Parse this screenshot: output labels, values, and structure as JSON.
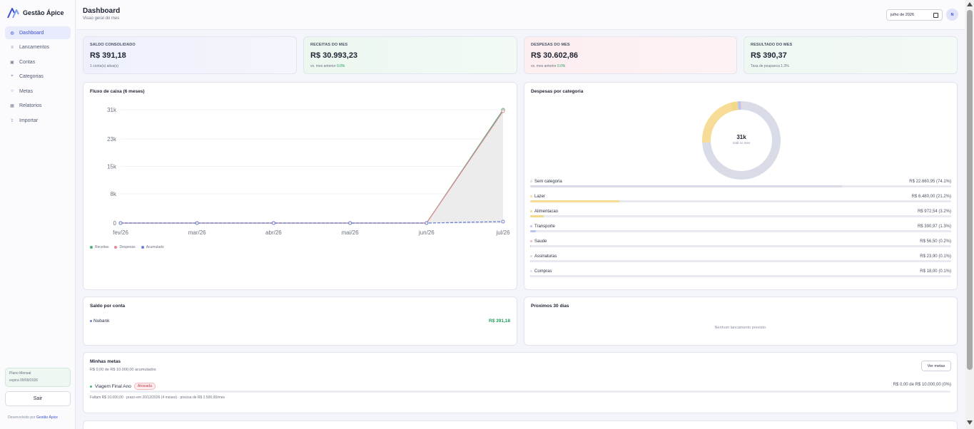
{
  "sidebar": {
    "brand": "Gestão Ápice",
    "items": [
      {
        "label": "Dashboard",
        "icon": "dashboard-icon",
        "glyph": "◍",
        "active": true
      },
      {
        "label": "Lancamentos",
        "icon": "list-icon",
        "glyph": "≡",
        "active": false
      },
      {
        "label": "Contas",
        "icon": "wallet-icon",
        "glyph": "▣",
        "active": false
      },
      {
        "label": "Categorias",
        "icon": "tag-icon",
        "glyph": "⌖",
        "active": false
      },
      {
        "label": "Metas",
        "icon": "target-icon",
        "glyph": "○",
        "active": false
      },
      {
        "label": "Relatorios",
        "icon": "report-icon",
        "glyph": "▦",
        "active": false
      },
      {
        "label": "Importar",
        "icon": "upload-icon",
        "glyph": "⇪",
        "active": false
      }
    ],
    "plan": {
      "title": "Plano Mensal",
      "expires": "expira 09/09/2026"
    },
    "logout": "Sair",
    "dev_prefix": "Desenvolvido por",
    "dev_link": "Gestão Ápice"
  },
  "header": {
    "title": "Dashboard",
    "subtitle": "Visao geral do mes",
    "date_value": "julho de 2026",
    "avatar_initial": "N"
  },
  "stats": [
    {
      "label": "SALDO CONSOLIDADO",
      "value": "R$ 391,18",
      "note": "1 conta(s) ativa(s)",
      "note_highlight": ""
    },
    {
      "label": "RECEITAS DO MES",
      "value": "R$ 30.993,23",
      "note": "vs. mes anterior",
      "note_highlight": "0.0%"
    },
    {
      "label": "DESPESAS DO MES",
      "value": "R$ 30.602,86",
      "note": "vs. mes anterior",
      "note_highlight": "0.0%"
    },
    {
      "label": "RESULTADO DO MES",
      "value": "R$ 390,37",
      "note": "Taxa de poupanca 1.3%",
      "note_highlight": ""
    }
  ],
  "cashflow": {
    "title": "Fluxo de caixa (6 meses)",
    "legend": [
      {
        "label": "Receitas",
        "color": "#4bb07a"
      },
      {
        "label": "Despesas",
        "color": "#e08a96"
      },
      {
        "label": "Acumulado",
        "color": "#6b7fd6"
      }
    ]
  },
  "chart_data": {
    "type": "line",
    "x": [
      "fev/26",
      "mar/26",
      "abr/26",
      "mai/26",
      "jun/26",
      "jul/26"
    ],
    "yticks": [
      "0",
      "8k",
      "15k",
      "23k",
      "31k"
    ],
    "ylim": [
      0,
      31000
    ],
    "series": [
      {
        "name": "Receitas",
        "color": "#4bb07a",
        "values": [
          0,
          0,
          0,
          0,
          0,
          30993.23
        ]
      },
      {
        "name": "Despesas",
        "color": "#e08a96",
        "values": [
          0,
          0,
          0,
          0,
          0,
          30602.86
        ]
      },
      {
        "name": "Acumulado",
        "color": "#6b7fd6",
        "values": [
          0,
          0,
          0,
          0,
          0,
          390.37
        ]
      }
    ]
  },
  "categories": {
    "title": "Despesas por categoria",
    "donut_value": "31k",
    "donut_label": "total no mes",
    "items": [
      {
        "name": "Sem categoria",
        "value": "R$ 22.660,95 (74.1%)",
        "pct": 74.1,
        "color": "#d9dbe6"
      },
      {
        "name": "Lazer",
        "value": "R$ 6.480,00 (21.2%)",
        "pct": 21.2,
        "color": "#f6dc96"
      },
      {
        "name": "Alimentacao",
        "value": "R$ 972,54 (3.2%)",
        "pct": 3.2,
        "color": "#f2d88a"
      },
      {
        "name": "Transporte",
        "value": "R$ 390,97 (1.3%)",
        "pct": 1.3,
        "color": "#b9c5ee"
      },
      {
        "name": "Saude",
        "value": "R$ 56,50 (0.2%)",
        "pct": 0.2,
        "color": "#f3b9bf"
      },
      {
        "name": "Assinaturas",
        "value": "R$ 23,90 (0.1%)",
        "pct": 0.1,
        "color": "#d9dbe6"
      },
      {
        "name": "Compras",
        "value": "R$ 18,00 (0.1%)",
        "pct": 0.1,
        "color": "#e6d6f5"
      }
    ]
  },
  "accounts": {
    "title": "Saldo por conta",
    "items": [
      {
        "name": "Nubank",
        "value": "R$ 391,18"
      }
    ]
  },
  "upcoming": {
    "title": "Proximos 30 dias",
    "empty": "Nenhum lancamento previsto."
  },
  "goals": {
    "title": "Minhas metas",
    "subtitle": "R$ 0,00 de R$ 10.000,00 acumulados",
    "button": "Ver metas",
    "items": [
      {
        "name": "Viagem Final Ano",
        "badge": "Atrasada",
        "value": "R$ 0,00 de R$ 10.000,00 (0%)",
        "note": "Faltam R$ 10.000,00 · prazo em 20/12/2026 (4 meses) · precisa de R$ 2.500,00/mes",
        "progress": 0
      }
    ]
  }
}
